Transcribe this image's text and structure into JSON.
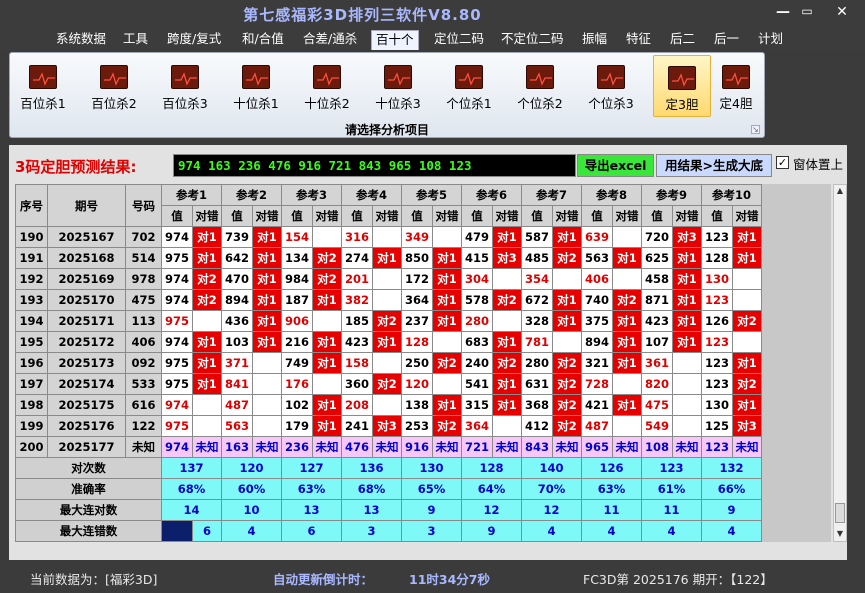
{
  "window": {
    "title": "第七感福彩3D排列三软件V8.80",
    "btn_min": "—",
    "btn_max": "▭",
    "btn_close": "✕"
  },
  "menu": [
    "系统数据",
    "工具",
    "跨度/复式",
    "和/合值",
    "合差/通杀",
    "百十个",
    "定位二码",
    "不定位二码",
    "振幅",
    "特征",
    "后二",
    "后一",
    "计划"
  ],
  "active_menu": "百十个",
  "ribbon": {
    "items": [
      "百位杀1",
      "百位杀2",
      "百位杀3",
      "十位杀1",
      "十位杀2",
      "十位杀3",
      "个位杀1",
      "个位杀2",
      "个位杀3",
      "定3胆",
      "定4胆"
    ],
    "selected": "定3胆",
    "caption": "请选择分析项目"
  },
  "prediction": {
    "label": "3码定胆预测结果:",
    "value": "974 163 236 476 916 721 843 965 108 123",
    "export_btn": "导出excel",
    "gen_btn": "用结果>生成大底",
    "checkbox_checked": true,
    "checkbox_label": "窗体置上"
  },
  "table": {
    "headers": {
      "seq": "序号",
      "period": "期号",
      "code": "号码",
      "refs": [
        "参考1",
        "参考2",
        "参考3",
        "参考4",
        "参考5",
        "参考6",
        "参考7",
        "参考8",
        "参考9",
        "参考10"
      ],
      "val": "值",
      "hit": "对错"
    },
    "rows": [
      {
        "seq": "190",
        "period": "2025167",
        "code": "702",
        "cells": [
          [
            "974",
            "对1"
          ],
          [
            "739",
            "对1"
          ],
          [
            "154",
            ""
          ],
          [
            "316",
            ""
          ],
          [
            "349",
            ""
          ],
          [
            "479",
            "对1"
          ],
          [
            "587",
            "对1"
          ],
          [
            "639",
            ""
          ],
          [
            "720",
            "对3"
          ],
          [
            "123",
            "对1"
          ]
        ]
      },
      {
        "seq": "191",
        "period": "2025168",
        "code": "514",
        "cells": [
          [
            "975",
            "对1"
          ],
          [
            "642",
            "对1"
          ],
          [
            "134",
            "对2"
          ],
          [
            "274",
            "对1"
          ],
          [
            "850",
            "对1"
          ],
          [
            "415",
            "对3"
          ],
          [
            "485",
            "对2"
          ],
          [
            "563",
            "对1"
          ],
          [
            "625",
            "对1"
          ],
          [
            "128",
            "对1"
          ]
        ]
      },
      {
        "seq": "192",
        "period": "2025169",
        "code": "978",
        "cells": [
          [
            "974",
            "对2"
          ],
          [
            "470",
            "对1"
          ],
          [
            "984",
            "对2"
          ],
          [
            "201",
            ""
          ],
          [
            "172",
            "对1"
          ],
          [
            "304",
            ""
          ],
          [
            "354",
            ""
          ],
          [
            "406",
            ""
          ],
          [
            "458",
            "对1"
          ],
          [
            "130",
            ""
          ]
        ]
      },
      {
        "seq": "193",
        "period": "2025170",
        "code": "475",
        "cells": [
          [
            "974",
            "对2"
          ],
          [
            "894",
            "对1"
          ],
          [
            "187",
            "对1"
          ],
          [
            "382",
            ""
          ],
          [
            "364",
            "对1"
          ],
          [
            "578",
            "对2"
          ],
          [
            "672",
            "对1"
          ],
          [
            "740",
            "对2"
          ],
          [
            "871",
            "对1"
          ],
          [
            "123",
            ""
          ]
        ]
      },
      {
        "seq": "194",
        "period": "2025171",
        "code": "113",
        "cells": [
          [
            "975",
            ""
          ],
          [
            "436",
            "对1"
          ],
          [
            "906",
            ""
          ],
          [
            "185",
            "对2"
          ],
          [
            "237",
            "对1"
          ],
          [
            "280",
            ""
          ],
          [
            "328",
            "对1"
          ],
          [
            "375",
            "对1"
          ],
          [
            "423",
            "对1"
          ],
          [
            "126",
            "对2"
          ]
        ]
      },
      {
        "seq": "195",
        "period": "2025172",
        "code": "406",
        "cells": [
          [
            "974",
            "对1"
          ],
          [
            "103",
            "对1"
          ],
          [
            "216",
            "对1"
          ],
          [
            "423",
            "对1"
          ],
          [
            "128",
            ""
          ],
          [
            "683",
            "对1"
          ],
          [
            "781",
            ""
          ],
          [
            "894",
            "对1"
          ],
          [
            "107",
            "对1"
          ],
          [
            "123",
            ""
          ]
        ]
      },
      {
        "seq": "196",
        "period": "2025173",
        "code": "092",
        "cells": [
          [
            "975",
            "对1"
          ],
          [
            "371",
            ""
          ],
          [
            "749",
            "对1"
          ],
          [
            "158",
            ""
          ],
          [
            "250",
            "对2"
          ],
          [
            "240",
            "对2"
          ],
          [
            "280",
            "对2"
          ],
          [
            "321",
            "对1"
          ],
          [
            "361",
            ""
          ],
          [
            "123",
            "对1"
          ]
        ]
      },
      {
        "seq": "197",
        "period": "2025174",
        "code": "533",
        "cells": [
          [
            "975",
            "对1"
          ],
          [
            "841",
            ""
          ],
          [
            "176",
            ""
          ],
          [
            "360",
            "对2"
          ],
          [
            "120",
            ""
          ],
          [
            "541",
            "对1"
          ],
          [
            "631",
            "对2"
          ],
          [
            "728",
            ""
          ],
          [
            "820",
            ""
          ],
          [
            "123",
            "对2"
          ]
        ]
      },
      {
        "seq": "198",
        "period": "2025175",
        "code": "616",
        "cells": [
          [
            "974",
            ""
          ],
          [
            "487",
            ""
          ],
          [
            "102",
            "对1"
          ],
          [
            "208",
            ""
          ],
          [
            "138",
            "对1"
          ],
          [
            "315",
            "对1"
          ],
          [
            "368",
            "对2"
          ],
          [
            "421",
            "对1"
          ],
          [
            "475",
            ""
          ],
          [
            "130",
            "对1"
          ]
        ]
      },
      {
        "seq": "199",
        "period": "2025176",
        "code": "122",
        "cells": [
          [
            "975",
            ""
          ],
          [
            "563",
            ""
          ],
          [
            "179",
            "对1"
          ],
          [
            "241",
            "对3"
          ],
          [
            "253",
            "对2"
          ],
          [
            "364",
            ""
          ],
          [
            "412",
            "对2"
          ],
          [
            "487",
            ""
          ],
          [
            "549",
            ""
          ],
          [
            "125",
            "对3"
          ]
        ]
      },
      {
        "seq": "200",
        "period": "2025177",
        "code": "未知",
        "cells": [
          [
            "974",
            "未知"
          ],
          [
            "163",
            "未知"
          ],
          [
            "236",
            "未知"
          ],
          [
            "476",
            "未知"
          ],
          [
            "916",
            "未知"
          ],
          [
            "721",
            "未知"
          ],
          [
            "843",
            "未知"
          ],
          [
            "965",
            "未知"
          ],
          [
            "108",
            "未知"
          ],
          [
            "123",
            "未知"
          ]
        ]
      }
    ],
    "summary": [
      {
        "label": "对次数",
        "values": [
          "137",
          "120",
          "127",
          "136",
          "130",
          "128",
          "140",
          "126",
          "123",
          "132"
        ]
      },
      {
        "label": "准确率",
        "values": [
          "68%",
          "60%",
          "63%",
          "68%",
          "65%",
          "64%",
          "70%",
          "63%",
          "61%",
          "66%"
        ]
      },
      {
        "label": "最大连对数",
        "values": [
          "14",
          "10",
          "13",
          "13",
          "9",
          "12",
          "12",
          "11",
          "11",
          "9"
        ]
      },
      {
        "label": "最大连错数",
        "values": [
          "6",
          "4",
          "6",
          "3",
          "3",
          "9",
          "4",
          "4",
          "4",
          "4"
        ]
      }
    ]
  },
  "status": {
    "current": "当前数据为：[福彩3D]",
    "countdown_label": "自动更新倒计时：",
    "countdown": "11时34分7秒",
    "issue": "FC3D第 2025176 期开：【122】"
  },
  "colors": {
    "hit": "#e60000",
    "title": "#a9b8ff",
    "pred_text": "#39ff14",
    "cyan": "#7ff8f8",
    "pink": "#f7c8f7"
  }
}
